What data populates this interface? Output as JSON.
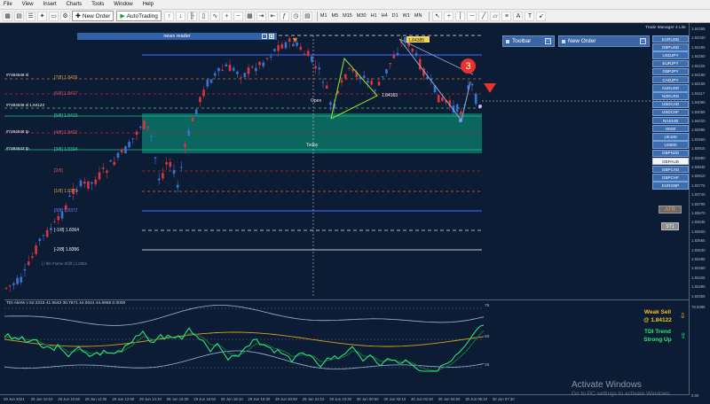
{
  "menu": [
    "File",
    "View",
    "Insert",
    "Charts",
    "Tools",
    "Window",
    "Help"
  ],
  "toolbar": {
    "new_order": "New Order",
    "autotrading": "AutoTrading",
    "timeframes": [
      "M1",
      "M5",
      "M15",
      "M30",
      "H1",
      "H4",
      "D1",
      "W1",
      "MN"
    ]
  },
  "news_reader": {
    "title": "news reader"
  },
  "panels": {
    "toolbar": "Toolbar",
    "new_order": "New Order"
  },
  "trade_manager": {
    "title": "Trade Manager 4 Lite",
    "symbols": [
      "EURUSD",
      "GBPUSD",
      "USDJPY",
      "EURJPY",
      "GBPJPY",
      "CADJPY",
      "AUDUSD",
      "NZDUSD",
      "USDCAD",
      "USDCHF",
      "NAS100",
      "HK50",
      "UK100",
      "US500",
      "GBPNZD",
      "GBPAUD",
      "GBPCAD",
      "GBPCHF",
      "EURGBP"
    ],
    "selected": "GBPAUD",
    "atr": "ATR",
    "s1": "ST1"
  },
  "chart_labels": {
    "orders": [
      "#7484648 sl",
      "#7484646 sl 1.84123",
      "#7484646 tp",
      "#7484643 tp"
    ],
    "murrey": [
      "[7/8] 1.8426",
      "[6/8] 1.8417",
      "[5/8] 1.8410",
      "[4/8] 1.8402",
      "[3/8] 1.8394",
      "[2/8]",
      "[1/8] 1.8379",
      "[0/8] 1.8372",
      "[-1/8] 1.8364",
      "[-2/8] 1.8356"
    ],
    "murrey_note": "[ / 8th Frame Shift ] 1.8352",
    "open": "Open",
    "today": "Today",
    "price_tag": "1.84163",
    "top_tag": "1.84385",
    "badge": "3"
  },
  "price_axis": [
    "1.84365",
    "1.84330",
    "1.84295",
    "1.84260",
    "1.84225",
    "1.84190",
    "1.84155",
    "1.84117",
    "1.84090",
    "1.84055",
    "1.84020",
    "1.83985",
    "1.83950",
    "1.83915",
    "1.83880",
    "1.83845",
    "1.83810",
    "1.83775",
    "1.83740",
    "1.83705",
    "1.83670",
    "1.83635",
    "1.83600",
    "1.83565",
    "1.83530",
    "1.83495",
    "1.83460",
    "1.83425",
    "1.83390",
    "1.83355",
    "78.9396",
    "0.00"
  ],
  "time_axis": [
    "29 Jun 2021",
    "29 Jun 10:10",
    "29 Jun 10:50",
    "29 Jun 11:30",
    "29 Jun 12:50",
    "29 Jun 14:10",
    "29 Jun 15:30",
    "29 Jun 16:50",
    "29 Jun 18:10",
    "29 Jun 19:30",
    "29 Jun 20:50",
    "29 Jun 22:10",
    "29 Jun 23:30",
    "30 Jun 00:50",
    "30 Jun 02:10",
    "30 Jun 03:30",
    "30 Jun 04:50",
    "30 Jun 06:10",
    "30 Jun 07:30"
  ],
  "indicator": {
    "title": "TDI Alerts v 52.3215 41.5543 30.7871 44.0041 44.6959 0.0000",
    "levels": [
      "75",
      "50",
      "25"
    ]
  },
  "signal": {
    "weak": "Weak Sell",
    "price": "@ 1.84122",
    "tdi1": "TDI Trend",
    "tdi2": "Strong Up"
  },
  "watermark": {
    "line1": "Activate Windows",
    "line2": "Go to PC settings to activate Windows."
  }
}
